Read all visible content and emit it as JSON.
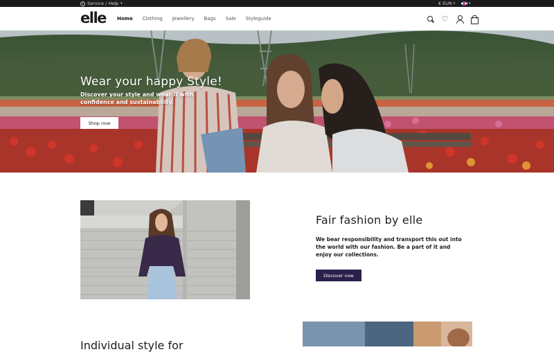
{
  "topbar": {
    "service_label": "Service / Help",
    "currency_label": "€ EUR",
    "icons": {
      "service": "clock-icon",
      "language": "uk-flag-icon",
      "caret": "chevron-down-icon"
    }
  },
  "header": {
    "logo_text": "elle",
    "nav": [
      {
        "label": "Home",
        "active": true
      },
      {
        "label": "Clothing"
      },
      {
        "label": "Jewellery"
      },
      {
        "label": "Bags"
      },
      {
        "label": "Sale"
      },
      {
        "label": "Styleguide"
      }
    ],
    "icons": [
      "search-icon",
      "heart-icon",
      "user-icon",
      "cart-icon"
    ]
  },
  "hero": {
    "title": "Wear your happy Style!",
    "subtitle": "Discover your style and wear it with confidence and sustainability.",
    "button_label": "Shop now"
  },
  "fair": {
    "title": "Fair fashion by elle",
    "text": "We bear responsibility and transport this out into the world with our fashion. Be a part of it and enjoy our collections.",
    "button_label": "Discover now"
  },
  "bottom": {
    "heading_partial": "Individual style for"
  },
  "colors": {
    "topbar_bg": "#1b1b1b",
    "accent": "#2b1f4c",
    "text": "#1e1e1e"
  }
}
